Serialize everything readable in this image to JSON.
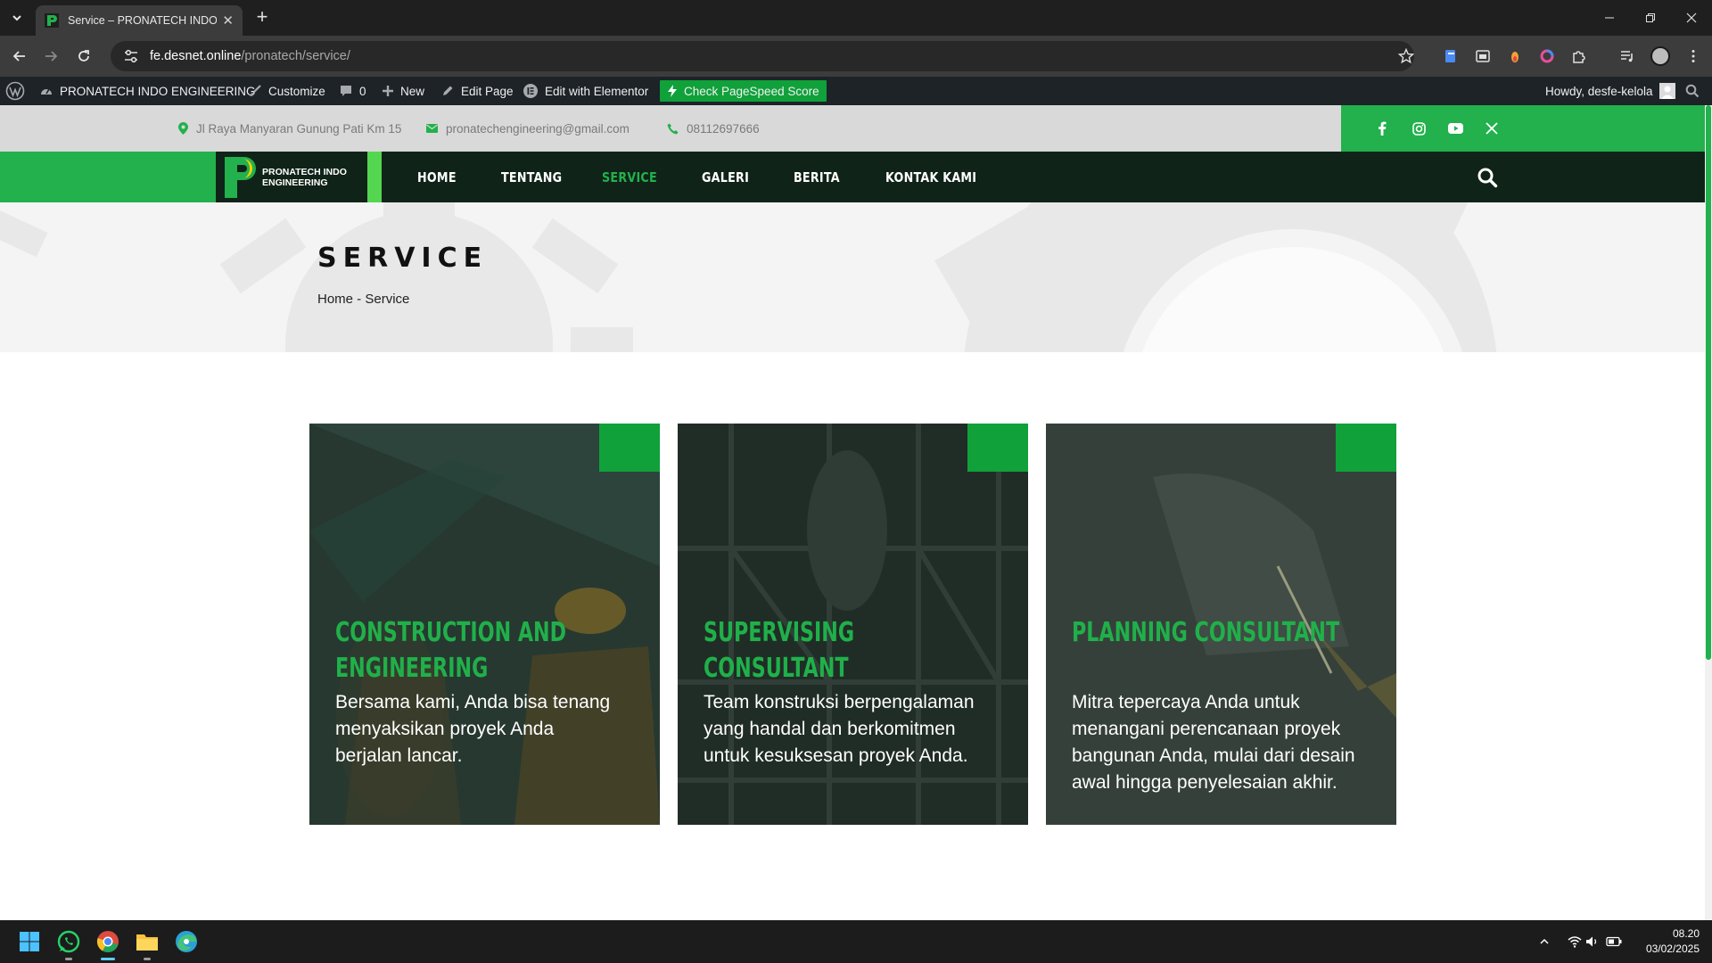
{
  "browser": {
    "tab_title": "Service – PRONATECH INDO ENGINEERING",
    "url_host": "fe.desnet.online",
    "url_path": "/pronatech/service/"
  },
  "wp_admin": {
    "site_name": "PRONATECH INDO ENGINEERING",
    "customize": "Customize",
    "comments_count": "0",
    "new": "New",
    "edit_page": "Edit Page",
    "edit_elementor": "Edit with Elementor",
    "pagespeed": "Check PageSpeed Score",
    "howdy": "Howdy, desfe-kelola"
  },
  "topbar": {
    "address": "Jl Raya Manyaran Gunung Pati Km 15",
    "email": "pronatechengineering@gmail.com",
    "phone": "08112697666"
  },
  "logo": {
    "line1": "PRONATECH INDO",
    "line2": "ENGINEERING"
  },
  "nav": {
    "items": [
      {
        "label": "HOME"
      },
      {
        "label": "TENTANG"
      },
      {
        "label": "SERVICE"
      },
      {
        "label": "GALERI"
      },
      {
        "label": "BERITA"
      },
      {
        "label": "KONTAK KAMI"
      }
    ]
  },
  "hero": {
    "title": "SERVICE",
    "breadcrumb_home": "Home",
    "breadcrumb_sep": " - ",
    "breadcrumb_current": "Service"
  },
  "cards": [
    {
      "title": "CONSTRUCTION AND ENGINEERING",
      "desc": "Bersama kami, Anda bisa tenang menyaksikan proyek Anda berjalan lancar."
    },
    {
      "title": "SUPERVISING CONSULTANT",
      "desc": "Team konstruksi berpengalaman yang handal dan berkomitmen untuk kesuksesan proyek Anda."
    },
    {
      "title": "PLANNING CONSULTANT",
      "desc": "Mitra tepercaya Anda untuk menangani perencanaan proyek bangunan Anda, mulai dari desain awal hingga penyelesaian akhir."
    }
  ],
  "taskbar": {
    "time": "08.20",
    "date": "03/02/2025"
  },
  "colors": {
    "brand_green": "#22b14c",
    "nav_dark": "#102319",
    "card_title": "#20b04a"
  }
}
